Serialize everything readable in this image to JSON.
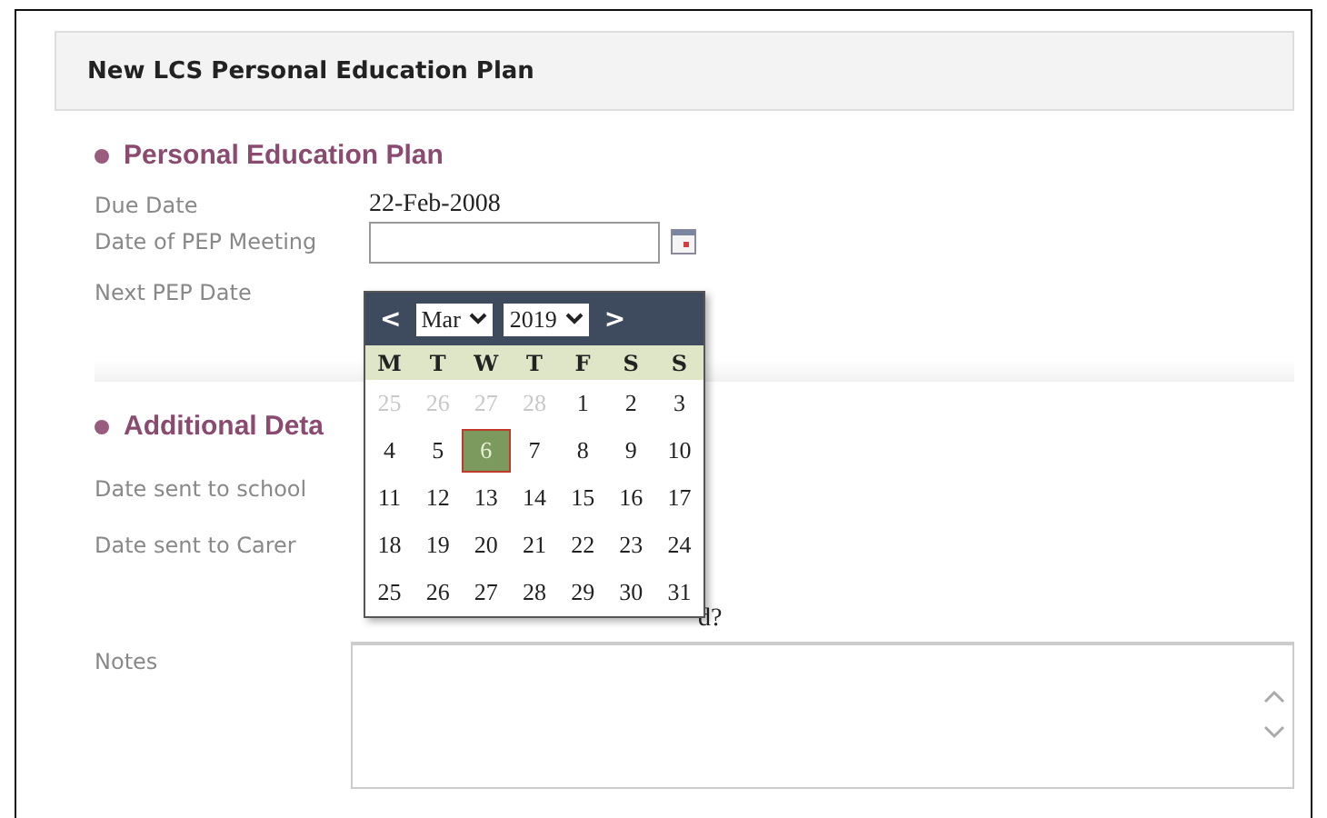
{
  "panel": {
    "title": "New LCS Personal Education Plan"
  },
  "sections": [
    {
      "title": "Personal Education Plan",
      "fields": [
        {
          "kind": "text",
          "label": "Due Date",
          "value": "22-Feb-2008"
        },
        {
          "kind": "date",
          "label": "Date of PEP Meeting"
        },
        {
          "kind": "hidden",
          "label": "Next PEP Date"
        }
      ]
    },
    {
      "title": "Additional Deta",
      "fields": [
        {
          "kind": "hidden",
          "label": "Date sent to school"
        },
        {
          "kind": "hidden",
          "label": "Date sent to Carer"
        },
        {
          "kind": "check-tail",
          "label": "d?"
        },
        {
          "kind": "textarea",
          "label": "Notes"
        }
      ]
    }
  ],
  "calendar": {
    "prev": "<",
    "month": "Mar",
    "year": "2019",
    "next": ">",
    "weekdays": [
      "M",
      "T",
      "W",
      "T",
      "F",
      "S",
      "S"
    ],
    "weeks": [
      [
        {
          "day": "25",
          "muted": true,
          "selected": false
        },
        {
          "day": "26",
          "muted": true,
          "selected": false
        },
        {
          "day": "27",
          "muted": true,
          "selected": false
        },
        {
          "day": "28",
          "muted": true,
          "selected": false
        },
        {
          "day": "1",
          "muted": false,
          "selected": false
        },
        {
          "day": "2",
          "muted": false,
          "selected": false
        },
        {
          "day": "3",
          "muted": false,
          "selected": false
        }
      ],
      [
        {
          "day": "4",
          "muted": false,
          "selected": false
        },
        {
          "day": "5",
          "muted": false,
          "selected": false
        },
        {
          "day": "6",
          "muted": false,
          "selected": true
        },
        {
          "day": "7",
          "muted": false,
          "selected": false
        },
        {
          "day": "8",
          "muted": false,
          "selected": false
        },
        {
          "day": "9",
          "muted": false,
          "selected": false
        },
        {
          "day": "10",
          "muted": false,
          "selected": false
        }
      ],
      [
        {
          "day": "11",
          "muted": false,
          "selected": false
        },
        {
          "day": "12",
          "muted": false,
          "selected": false
        },
        {
          "day": "13",
          "muted": false,
          "selected": false
        },
        {
          "day": "14",
          "muted": false,
          "selected": false
        },
        {
          "day": "15",
          "muted": false,
          "selected": false
        },
        {
          "day": "16",
          "muted": false,
          "selected": false
        },
        {
          "day": "17",
          "muted": false,
          "selected": false
        }
      ],
      [
        {
          "day": "18",
          "muted": false,
          "selected": false
        },
        {
          "day": "19",
          "muted": false,
          "selected": false
        },
        {
          "day": "20",
          "muted": false,
          "selected": false
        },
        {
          "day": "21",
          "muted": false,
          "selected": false
        },
        {
          "day": "22",
          "muted": false,
          "selected": false
        },
        {
          "day": "23",
          "muted": false,
          "selected": false
        },
        {
          "day": "24",
          "muted": false,
          "selected": false
        }
      ],
      [
        {
          "day": "25",
          "muted": false,
          "selected": false
        },
        {
          "day": "26",
          "muted": false,
          "selected": false
        },
        {
          "day": "27",
          "muted": false,
          "selected": false
        },
        {
          "day": "28",
          "muted": false,
          "selected": false
        },
        {
          "day": "29",
          "muted": false,
          "selected": false
        },
        {
          "day": "30",
          "muted": false,
          "selected": false
        },
        {
          "day": "31",
          "muted": false,
          "selected": false
        }
      ]
    ]
  }
}
